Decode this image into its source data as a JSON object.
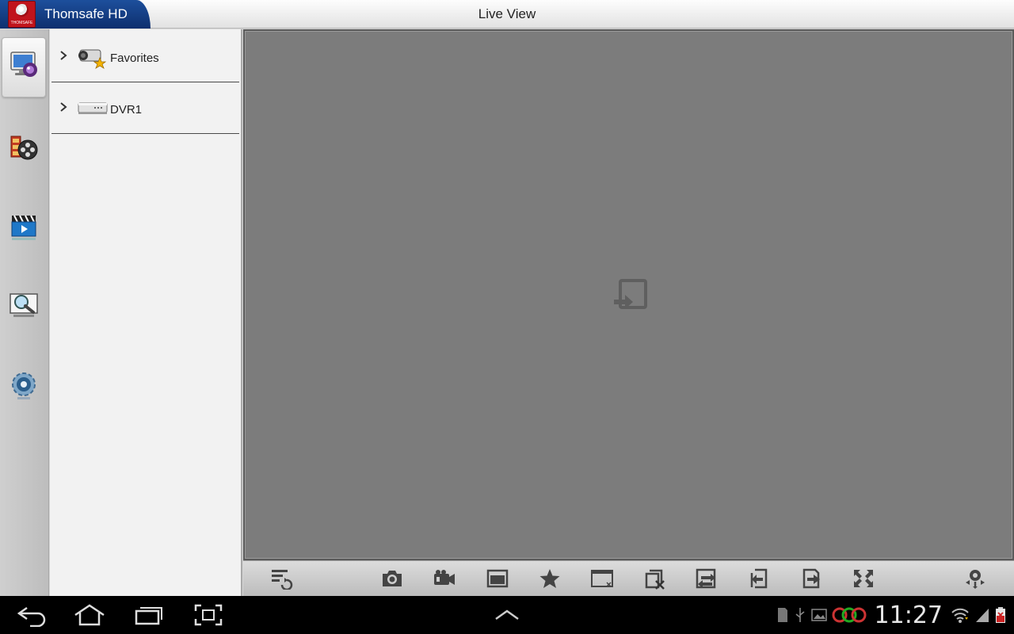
{
  "app": {
    "name": "Thomsafe HD",
    "logo_text": "THOMSAFE"
  },
  "header": {
    "title": "Live View"
  },
  "rail": {
    "items": [
      {
        "name": "live-view-monitor-icon",
        "active": true
      },
      {
        "name": "playback-film-reel-icon",
        "active": false
      },
      {
        "name": "local-video-clapper-icon",
        "active": false
      },
      {
        "name": "image-search-icon",
        "active": false
      },
      {
        "name": "settings-gear-icon",
        "active": false
      }
    ]
  },
  "device_tree": {
    "items": [
      {
        "label": "Favorites",
        "icon": "favorite-camera-icon"
      },
      {
        "label": "DVR1",
        "icon": "dvr-device-icon"
      }
    ]
  },
  "toolbar": {
    "buttons": [
      "channel-list-icon",
      "snapshot-camera-icon",
      "record-video-icon",
      "gallery-icon",
      "favorite-star-icon",
      "close-window-icon",
      "stop-all-icon",
      "switch-stream-icon",
      "previous-page-icon",
      "next-page-icon",
      "fullscreen-icon",
      "ptz-control-icon"
    ]
  },
  "system_bar": {
    "clock": "11:27",
    "nav": [
      "back-icon",
      "home-icon",
      "recent-apps-icon",
      "screenshot-icon",
      "expand-up-icon"
    ],
    "status_icons": [
      "sd-card-icon",
      "usb-icon",
      "gallery-notification-icon",
      "app-notification-icon",
      "wifi-icon",
      "signal-icon",
      "battery-icon"
    ]
  },
  "colors": {
    "brand_blue": "#1d4f9c",
    "logo_red": "#c0141c",
    "view_gray": "#7c7c7c",
    "panel_bg": "#f2f2f2"
  }
}
